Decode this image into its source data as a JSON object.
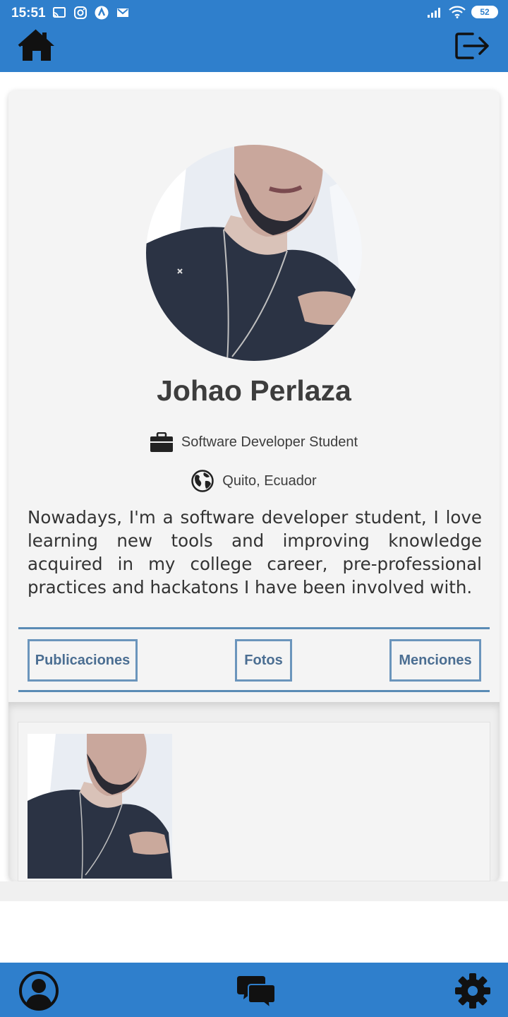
{
  "status_bar": {
    "time": "15:51",
    "notification_icons": [
      "cast-icon",
      "instagram-icon",
      "app-a-icon",
      "gmail-icon"
    ],
    "battery": "52"
  },
  "top_bar": {
    "background": "#2f7fcc",
    "left_icon": "home-icon",
    "right_icon": "logout-icon"
  },
  "profile": {
    "name": "Johao Perlaza",
    "occupation": "Software Developer Student",
    "location": "Quito, Ecuador",
    "bio": "Nowadays, I'm a software developer student, I love  learning new tools and improving knowledge acquired in my college career, pre-professional practices and hackatons I have been involved with."
  },
  "tabs": [
    {
      "label": "Publicaciones"
    },
    {
      "label": "Fotos"
    },
    {
      "label": "Menciones"
    }
  ],
  "accent": "#5a8bb5",
  "bottom_nav": {
    "items": [
      "profile-icon",
      "chat-icon",
      "settings-icon"
    ]
  }
}
